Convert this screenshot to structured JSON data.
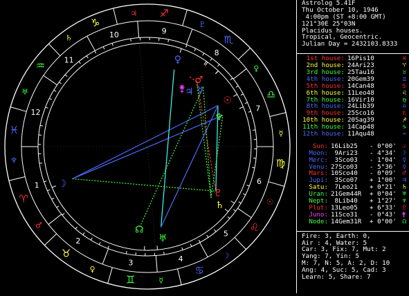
{
  "colors": {
    "background": "#000000",
    "wheel": "#ffffff",
    "sun": "#ff3030",
    "moon": "#4a6bff",
    "mercury": "#4a6bff",
    "venus": "#4a6bff",
    "mars": "#ff3030",
    "jupiter": "#4a6bff",
    "saturn": "#ffff40",
    "uranus": "#40ff40",
    "neptune": "#40ff40",
    "pluto": "#ff3030",
    "juno": "#ff40ff",
    "node": "#40ff40",
    "fire": "#ff3030",
    "earth": "#ffff40",
    "air": "#40ff40",
    "water": "#4a6bff",
    "aspect_square": "#ff3030",
    "aspect_trine": "#4a6bff",
    "aspect_sextile": "#40ffff",
    "aspect_quincunx": "#40ff40"
  },
  "header": [
    "Astrolog 5.41F",
    "Thu October 10, 1946",
    " 4:00pm (ST +8:00 GMT)",
    "121°30E 25°03N",
    "Placidus houses.",
    "Tropical, Geocentric.",
    "Julian Day = 2432103.8333"
  ],
  "houses": [
    {
      "label": "1st house:",
      "value": "16Pis10",
      "color": "#ff3030",
      "glyph": "♓"
    },
    {
      "label": "2nd house:",
      "value": "24Ari23",
      "color": "#ffff40",
      "glyph": "♈"
    },
    {
      "label": "3rd house:",
      "value": "25Tau16",
      "color": "#40ff40",
      "glyph": "♉"
    },
    {
      "label": "4th house:",
      "value": "20Gem39",
      "color": "#4a6bff",
      "glyph": "♊"
    },
    {
      "label": "5th house:",
      "value": "14Can48",
      "color": "#ff3030",
      "glyph": "♋"
    },
    {
      "label": "6th house:",
      "value": "11Leo48",
      "color": "#ffff40",
      "glyph": "♌"
    },
    {
      "label": "7th house:",
      "value": "16Vir10",
      "color": "#40ff40",
      "glyph": "♍"
    },
    {
      "label": "8th house:",
      "value": "24Lib39",
      "color": "#4a6bff",
      "glyph": "♎"
    },
    {
      "label": "9th house:",
      "value": "25Sco16",
      "color": "#ff3030",
      "glyph": "♏"
    },
    {
      "label": "10th house:",
      "value": "20Sag39",
      "color": "#ffff40",
      "glyph": "♐"
    },
    {
      "label": "11th house:",
      "value": "14Cap48",
      "color": "#40ff40",
      "glyph": "♑"
    },
    {
      "label": "12th house:",
      "value": "11Aqu48",
      "color": "#4a6bff",
      "glyph": "♒"
    }
  ],
  "planets": [
    {
      "label": "Sun:",
      "value": "16Lib25",
      "speed": "- 0°00'",
      "color": "#ff3030",
      "glyph": "☉"
    },
    {
      "label": "Moon:",
      "value": " 9Ari23",
      "speed": "- 4°34'",
      "color": "#4a6bff",
      "glyph": "☽"
    },
    {
      "label": "Merc:",
      "value": " 3Sco03",
      "speed": "- 1°04'",
      "color": "#4a6bff",
      "glyph": "☿"
    },
    {
      "label": "Venu:",
      "value": "27Sco03",
      "speed": "- 5°36'",
      "color": "#4a6bff",
      "glyph": "♀"
    },
    {
      "label": "Mars:",
      "value": "10Sco40",
      "speed": "- 0°09'",
      "color": "#ff3030",
      "glyph": "♂"
    },
    {
      "label": "Jupi:",
      "value": " 3Sco07",
      "speed": "+ 1°00'",
      "color": "#4a6bff",
      "glyph": "♃"
    },
    {
      "label": "Satu:",
      "value": " 7Leo21",
      "speed": "+ 0°21'",
      "color": "#ffff40",
      "glyph": "♄"
    },
    {
      "label": "Uran:",
      "value": "21Gem44R",
      "speed": "+ 0°04'",
      "color": "#40ff40",
      "glyph": "♅"
    },
    {
      "label": "Nept:",
      "value": " 8Lib40",
      "speed": "+ 1°27'",
      "color": "#40ff40",
      "glyph": "♆"
    },
    {
      "label": "Plut:",
      "value": "13Leo05",
      "speed": "+ 6°33'",
      "color": "#ff3030",
      "glyph": "♇"
    },
    {
      "label": "Juno:",
      "value": "11Sco31",
      "speed": "- 0°43'",
      "color": "#ff40ff",
      "glyph": "⚵"
    },
    {
      "label": "Node:",
      "value": "14Gem31R",
      "speed": "+ 0°00'",
      "color": "#40ff40",
      "glyph": "☊"
    }
  ],
  "summary": [
    "Fire: 3, Earth: 0,",
    "Air : 4, Water: 5",
    "Car: 3, Fix: 7, Mut: 2",
    "Yang: 7, Yin: 5",
    "M: 7, N: 5, A: 2, D: 10",
    "Ang: 4, Suc: 5, Cad: 3",
    "Learn: 5, Share: 7"
  ],
  "wheel": {
    "house_numbers": [
      "1",
      "2",
      "3",
      "4",
      "5",
      "6",
      "7",
      "8",
      "9",
      "10",
      "11",
      "12"
    ],
    "signs": [
      {
        "glyph": "♈",
        "name": "aries",
        "color": "#ff3030"
      },
      {
        "glyph": "♉",
        "name": "taurus",
        "color": "#ffff40"
      },
      {
        "glyph": "♊",
        "name": "gemini",
        "color": "#40ff40"
      },
      {
        "glyph": "♋",
        "name": "cancer",
        "color": "#4a6bff"
      },
      {
        "glyph": "♌",
        "name": "leo",
        "color": "#ff3030"
      },
      {
        "glyph": "♍",
        "name": "virgo",
        "color": "#ffff40"
      },
      {
        "glyph": "♎",
        "name": "libra",
        "color": "#40ff40"
      },
      {
        "glyph": "♏",
        "name": "scorpio",
        "color": "#4a6bff"
      },
      {
        "glyph": "♐",
        "name": "sagittarius",
        "color": "#ff3030"
      },
      {
        "glyph": "♑",
        "name": "capricorn",
        "color": "#ffff40"
      },
      {
        "glyph": "♒",
        "name": "aquarius",
        "color": "#40ff40"
      },
      {
        "glyph": "♓",
        "name": "pisces",
        "color": "#4a6bff"
      }
    ],
    "ruler_glyphs": [
      "♂",
      "♀",
      "☿",
      "☽",
      "☉",
      "☿",
      "♀",
      "♇",
      "♃",
      "♄",
      "♅",
      "♆"
    ]
  }
}
